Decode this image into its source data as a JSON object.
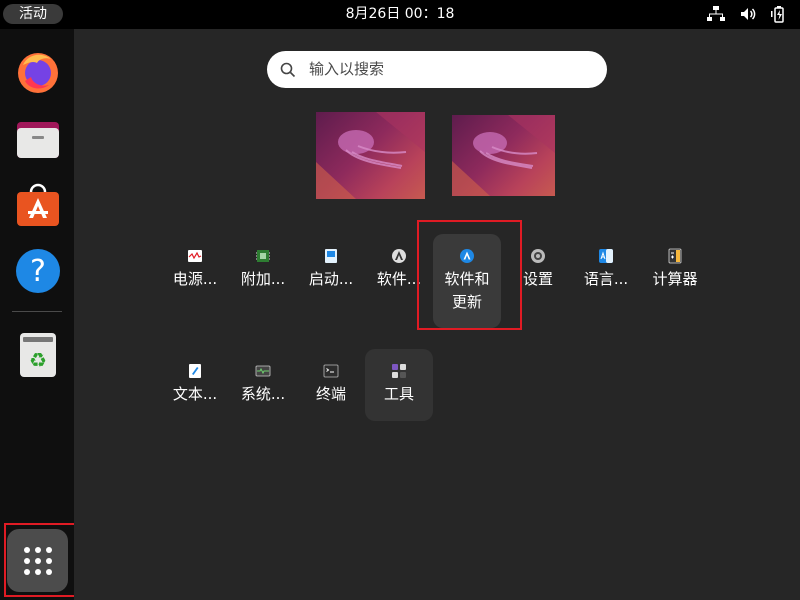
{
  "topbar": {
    "activities_label": "活动",
    "clock": "8月26日  00：18",
    "icons": [
      "network-icon",
      "volume-icon",
      "battery-icon"
    ]
  },
  "dock": {
    "items": [
      {
        "name": "Firefox",
        "icon": "firefox-icon"
      },
      {
        "name": "Files",
        "icon": "files-icon"
      },
      {
        "name": "Ubuntu Software",
        "icon": "software-store-icon"
      },
      {
        "name": "Help",
        "icon": "help-icon",
        "glyph": "?"
      },
      {
        "name": "Trash",
        "icon": "trash-icon",
        "glyph": "♻"
      }
    ],
    "show_apps_icon": "app-grid-icon"
  },
  "search": {
    "placeholder": "输入以搜索"
  },
  "workspaces": [
    "workspace-1",
    "workspace-2"
  ],
  "app_grid": {
    "row1": [
      {
        "label": "电源...",
        "icon": "power-stats-icon"
      },
      {
        "label": "附加...",
        "icon": "additional-drivers-icon"
      },
      {
        "label": "启动...",
        "icon": "startup-disk-icon"
      },
      {
        "label": "软件...",
        "icon": "software-icon"
      },
      {
        "label": "软件和\n更新",
        "label_line1": "软件和",
        "label_line2": "更新",
        "icon": "software-updates-icon"
      },
      {
        "label": "设置",
        "icon": "settings-icon"
      },
      {
        "label": "语言...",
        "icon": "language-icon"
      },
      {
        "label": "计算器",
        "icon": "calculator-icon"
      }
    ],
    "row2": [
      {
        "label": "文本...",
        "icon": "text-editor-icon"
      },
      {
        "label": "系统...",
        "icon": "system-monitor-icon"
      },
      {
        "label": "终端",
        "icon": "terminal-icon"
      },
      {
        "label": "工具",
        "icon": "utilities-folder-icon"
      }
    ]
  },
  "colors": {
    "highlight": "#e01b24",
    "background": "#262626",
    "dock": "#0f0f0f"
  }
}
